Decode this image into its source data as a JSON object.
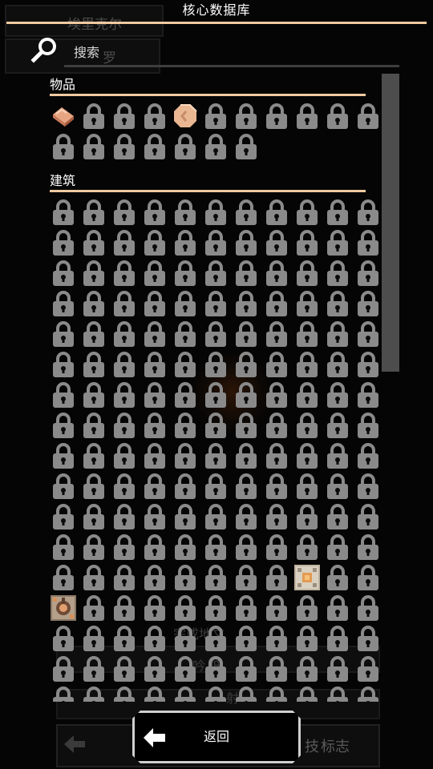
{
  "title": "核心数据库",
  "search": {
    "placeholder": "搜索"
  },
  "background_ghost_text": {
    "panel_1": "埃里克尔",
    "panel_2": "罗",
    "bottom_1": "完成地文",
    "bottom_2": "吟 低",
    "bottom_3": "射",
    "bottom_4": "技",
    "bottom_5": "标志"
  },
  "sections": [
    {
      "title": "物品",
      "unlocked_items": [
        {
          "index": 0,
          "icon": "copper-ingot-icon",
          "color": "#e8a581"
        },
        {
          "index": 4,
          "icon": "copper-ore-icon",
          "color": "#e9b792"
        }
      ],
      "count": 18
    },
    {
      "title": "建筑",
      "unlocked_items": [
        {
          "index": 140,
          "icon": "core-block-icon",
          "color": "#d7c9b3"
        },
        {
          "index": 143,
          "icon": "turret-block-icon",
          "color": "#c89b74"
        }
      ],
      "count": 187
    }
  ],
  "back_button": {
    "label": "返回"
  },
  "colors": {
    "accent": "#f1c9a0",
    "lock": "#8a8a8a",
    "scrollbar": "#4d4d4d"
  }
}
